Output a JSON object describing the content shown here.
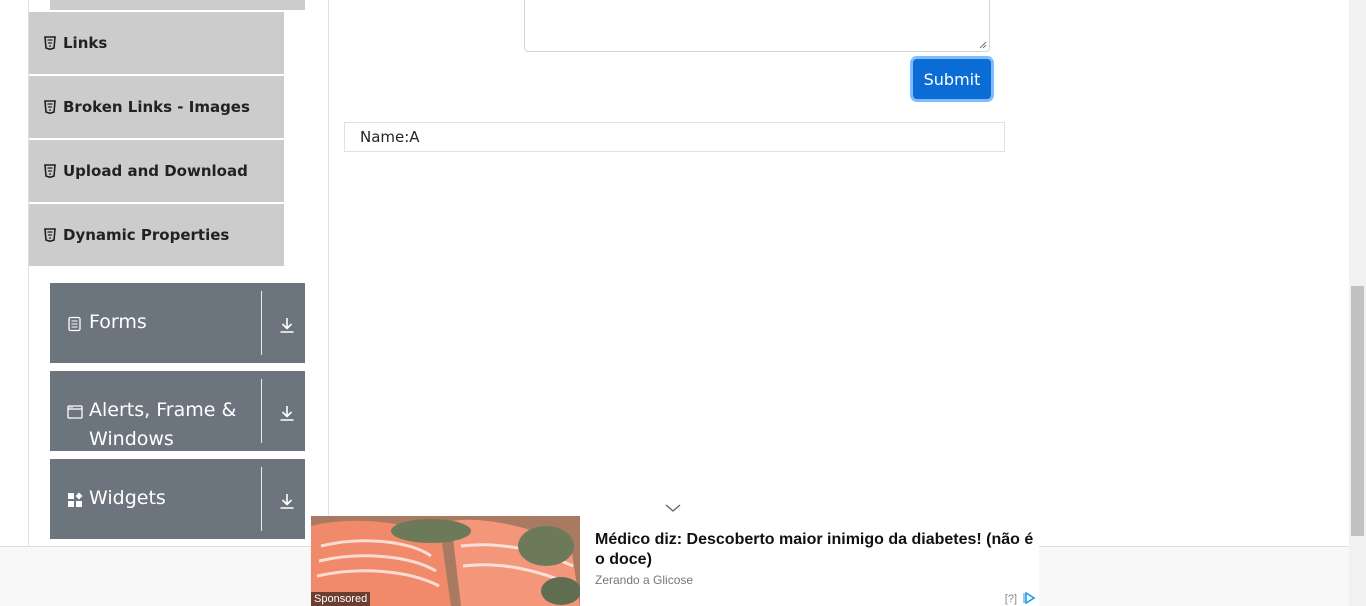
{
  "sidebar": {
    "sub_items": [
      {
        "label": "Links",
        "icon": "html5-icon"
      },
      {
        "label": "Broken Links - Images",
        "icon": "html5-icon"
      },
      {
        "label": "Upload and Download",
        "icon": "html5-icon"
      },
      {
        "label": "Dynamic Properties",
        "icon": "html5-icon"
      }
    ],
    "groups": [
      {
        "title": "Forms",
        "icon": "form-icon"
      },
      {
        "title": "Alerts, Frame & Windows",
        "icon": "window-icon"
      },
      {
        "title": "Widgets",
        "icon": "widgets-icon"
      }
    ]
  },
  "form": {
    "submit_label": "Submit",
    "output_text": "Name:A"
  },
  "ad": {
    "headline": "Médico diz: Descoberto maior inimigo da diabetes! (não é o doce)",
    "source": "Zerando a Glicose",
    "sponsored_label": "Sponsored",
    "info_label": "[?]"
  },
  "colors": {
    "sub_item_bg": "#cccccc",
    "group_bg": "#6c757d",
    "submit_bg": "#0b6cd6"
  }
}
